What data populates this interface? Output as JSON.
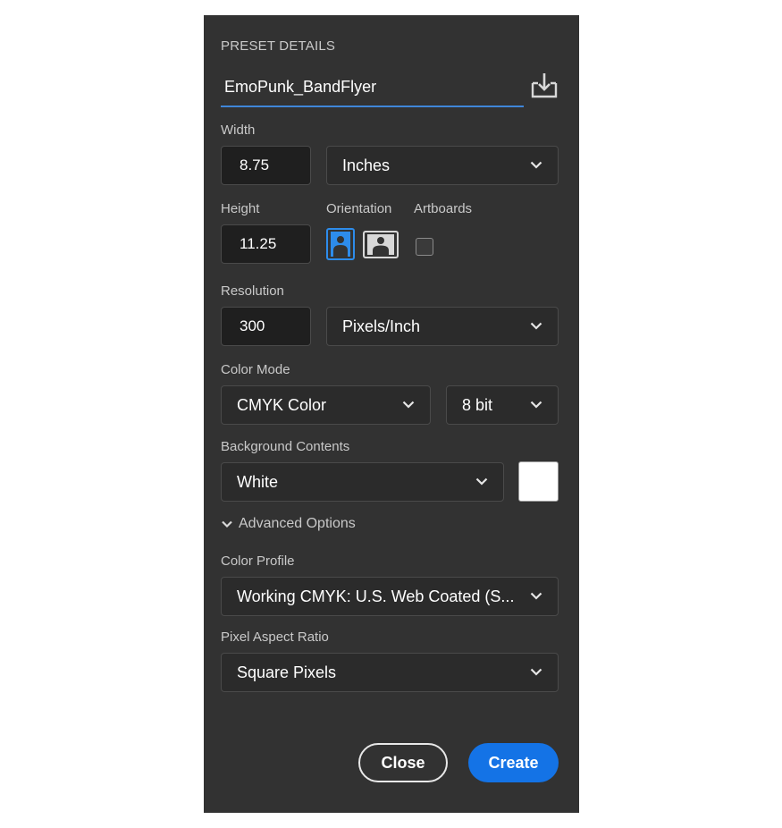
{
  "preset": {
    "section_title": "PRESET DETAILS",
    "name": "EmoPunk_BandFlyer",
    "save_icon": "save-preset-icon"
  },
  "width": {
    "label": "Width",
    "value": "8.75",
    "unit": "Inches"
  },
  "height": {
    "label": "Height",
    "value": "11.25"
  },
  "orientation": {
    "label": "Orientation",
    "selected": "portrait"
  },
  "artboards": {
    "label": "Artboards",
    "checked": false
  },
  "resolution": {
    "label": "Resolution",
    "value": "300",
    "unit": "Pixels/Inch"
  },
  "color_mode": {
    "label": "Color Mode",
    "mode": "CMYK Color",
    "depth": "8 bit"
  },
  "background": {
    "label": "Background Contents",
    "value": "White",
    "swatch_color": "#ffffff"
  },
  "advanced": {
    "label": "Advanced Options"
  },
  "color_profile": {
    "label": "Color Profile",
    "value": "Working CMYK: U.S. Web Coated (S..."
  },
  "pixel_aspect": {
    "label": "Pixel Aspect Ratio",
    "value": "Square Pixels"
  },
  "buttons": {
    "close": "Close",
    "create": "Create"
  },
  "colors": {
    "panel_bg": "#323232",
    "accent": "#1473e6",
    "selected_orientation": "#2d8ceb",
    "text": "#ffffff",
    "label": "#c9c9c9"
  }
}
